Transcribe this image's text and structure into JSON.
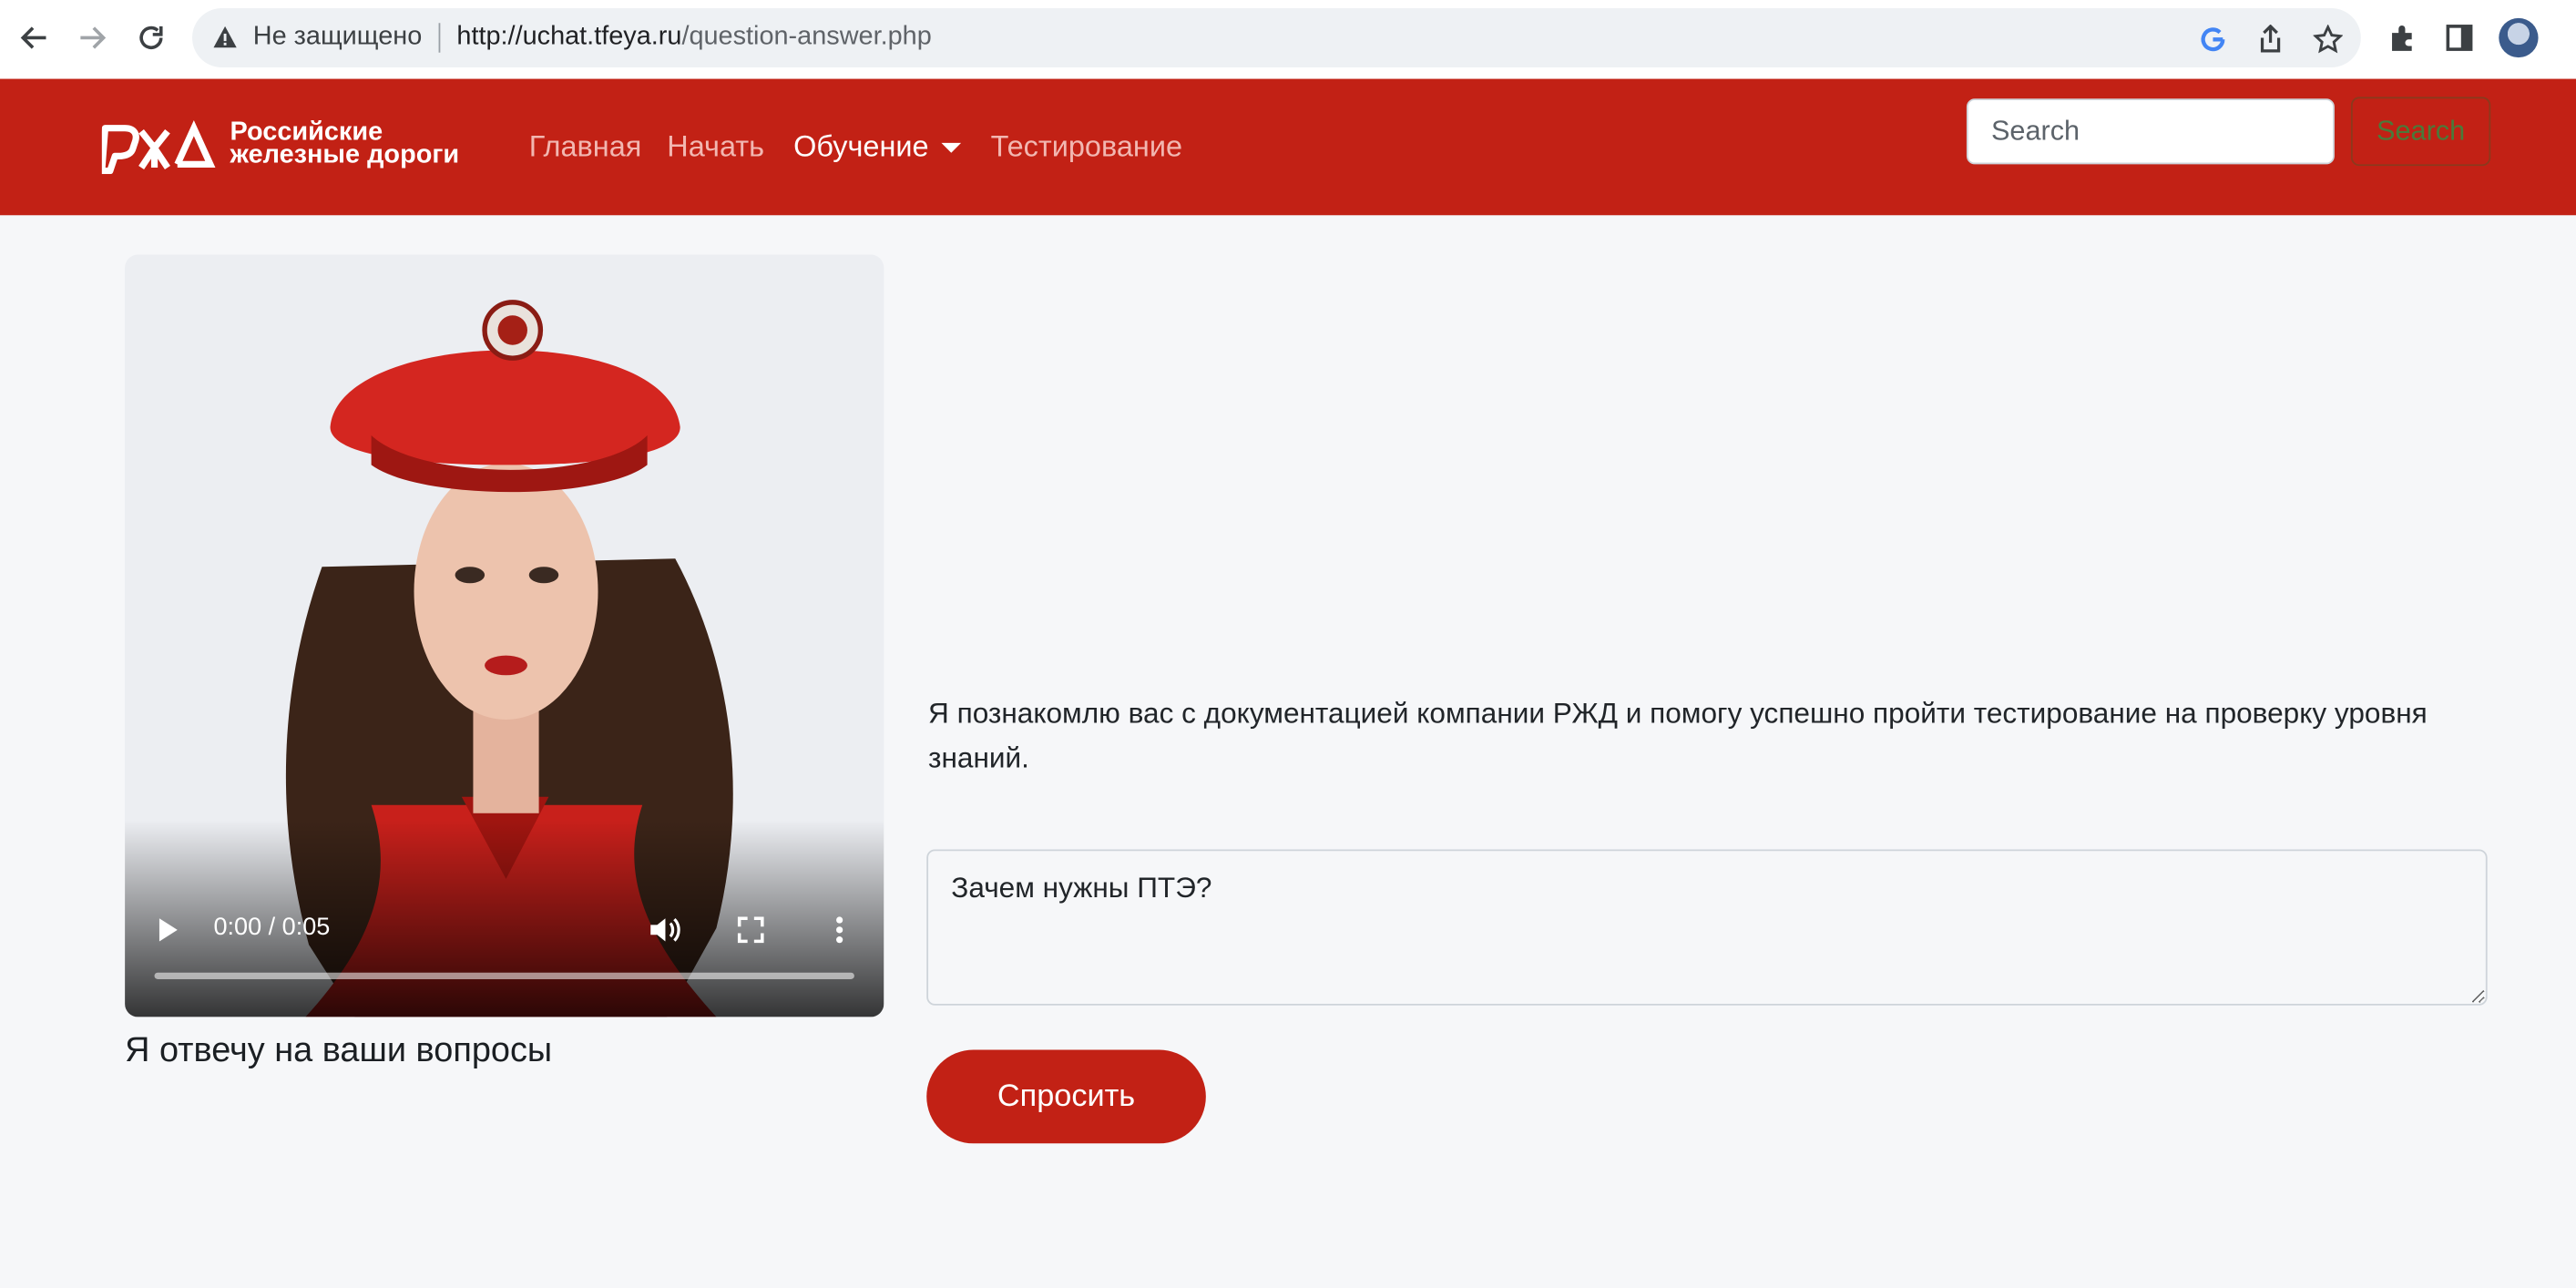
{
  "browser": {
    "security_label": "Не защищено",
    "url_host": "http://uchat.tfeya.ru",
    "url_path": "/question-answer.php"
  },
  "navbar": {
    "brand_line1": "Российские",
    "brand_line2": "железные дороги",
    "links": [
      {
        "label": "Главная"
      },
      {
        "label": "Начать"
      },
      {
        "label": "Обучение"
      },
      {
        "label": "Тестирование"
      }
    ],
    "search": {
      "placeholder": "Search",
      "button_label": "Search"
    },
    "colors": {
      "brand": "#c22115"
    }
  },
  "video": {
    "time": "0:00 / 0:05",
    "progress": 0
  },
  "caption": "Я отвечу на ваши вопросы",
  "intro": "Я познакомлю вас с документацией компании РЖД и помогу успешно пройти тестирование на проверку уровня знаний.",
  "question": {
    "value": "Зачем нужны ПТЭ?"
  },
  "ask_button": "Спросить"
}
